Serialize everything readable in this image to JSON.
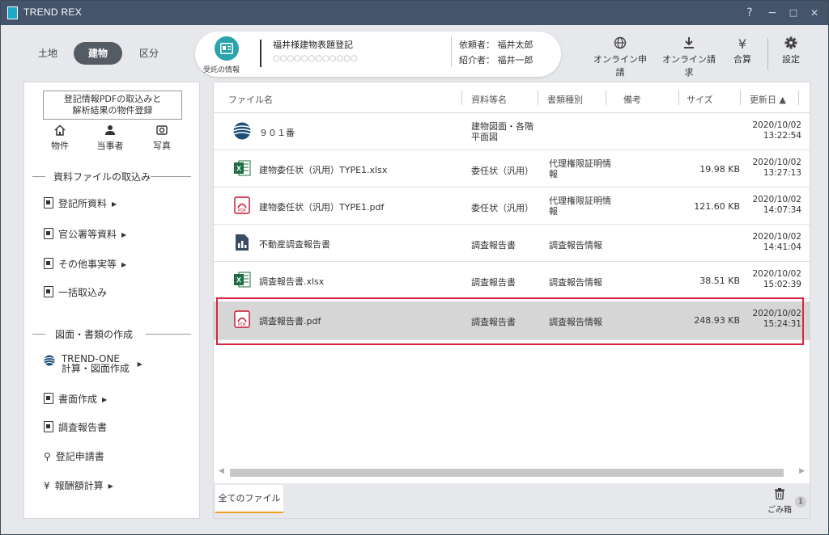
{
  "app": {
    "title": "TREND REX"
  },
  "window_controls": {
    "help": "?",
    "minimize": "−",
    "maximize": "□",
    "close": "✕"
  },
  "header": {
    "tabs": [
      {
        "label": "土地",
        "active": false
      },
      {
        "label": "建物",
        "active": true
      },
      {
        "label": "区分",
        "active": false
      }
    ],
    "case": {
      "badge_label": "受託の情報",
      "title": "福井様建物表題登記",
      "subtitle": "○○○○○○○○○○○○",
      "requester": "依頼者： 福井太郎",
      "introducer": "紹介者： 福井一郎"
    },
    "tools": [
      {
        "label": "オンライン申請",
        "icon": "globe-icon"
      },
      {
        "label": "オンライン請求",
        "icon": "download-icon"
      },
      {
        "label": "合算",
        "icon": "yen-icon"
      },
      {
        "label": "設定",
        "icon": "gear-icon"
      }
    ]
  },
  "sidebar": {
    "import_button": "登記情報PDFの取込みと\n解析結果の物件登録",
    "quick": [
      {
        "label": "物件",
        "icon": "home-icon"
      },
      {
        "label": "当事者",
        "icon": "person-icon"
      },
      {
        "label": "写真",
        "icon": "camera-icon"
      }
    ],
    "section1": "資料ファイルの取込み",
    "section1_items": [
      {
        "label": "登記所資料"
      },
      {
        "label": "官公署等資料"
      },
      {
        "label": "その他事実等"
      },
      {
        "label": "一括取込み"
      }
    ],
    "section2": "図面・書類の作成",
    "trend_one_line1": "TREND-ONE",
    "trend_one_line2": "計算・図面作成",
    "section2_items": [
      {
        "label": "書面作成"
      },
      {
        "label": "調査報告書"
      },
      {
        "label": "登記申請書"
      },
      {
        "label": "報酬額計算"
      }
    ]
  },
  "table": {
    "headers": {
      "name": "ファイル名",
      "resource": "資料等名",
      "doctype": "書類種別",
      "notes": "備考",
      "size": "サイズ",
      "updated": "更新日 ▲"
    },
    "rows": [
      {
        "icon": "trend-one-icon",
        "name": "９０１番",
        "resource1": "建物図面・各階",
        "resource2": "平面図",
        "doctype1": "",
        "doctype2": "",
        "size": "",
        "date": "2020/10/02",
        "time": "13:22:54"
      },
      {
        "icon": "excel-icon",
        "name": "建物委任状（汎用）TYPE1.xlsx",
        "resource1": "委任状（汎用）",
        "resource2": "",
        "doctype1": "代理権限証明情",
        "doctype2": "報",
        "size": "19.98 KB",
        "date": "2020/10/02",
        "time": "13:27:13"
      },
      {
        "icon": "pdf-icon",
        "name": "建物委任状（汎用）TYPE1.pdf",
        "resource1": "委任状（汎用）",
        "resource2": "",
        "doctype1": "代理権限証明情",
        "doctype2": "報",
        "size": "121.60 KB",
        "date": "2020/10/02",
        "time": "14:07:34"
      },
      {
        "icon": "report-icon",
        "name": "不動産調査報告書",
        "resource1": "調査報告書",
        "resource2": "",
        "doctype1": "調査報告情報",
        "doctype2": "",
        "size": "",
        "date": "2020/10/02",
        "time": "14:41:04"
      },
      {
        "icon": "excel-icon",
        "name": "調査報告書.xlsx",
        "resource1": "調査報告書",
        "resource2": "",
        "doctype1": "調査報告情報",
        "doctype2": "",
        "size": "38.51 KB",
        "date": "2020/10/02",
        "time": "15:02:39"
      },
      {
        "icon": "pdf-icon",
        "name": "調査報告書.pdf",
        "resource1": "調査報告書",
        "resource2": "",
        "doctype1": "調査報告情報",
        "doctype2": "",
        "size": "248.93 KB",
        "date": "2020/10/02",
        "time": "15:24:31",
        "selected": true
      }
    ]
  },
  "bottom": {
    "tab": "全てのファイル",
    "trash": "ごみ箱",
    "trash_count": "1"
  },
  "colors": {
    "titlebar": "#44546a",
    "accent": "#2aa3ac",
    "selection": "#d7263d",
    "tab_underline": "#f0a020"
  }
}
